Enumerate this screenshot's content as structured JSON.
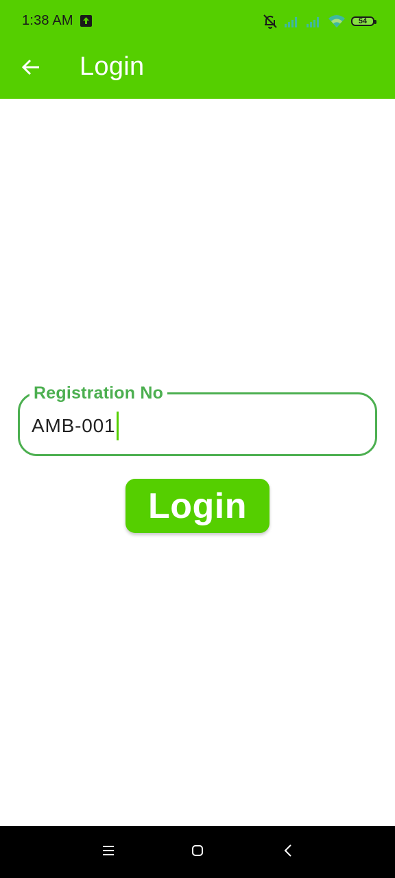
{
  "status_bar": {
    "time": "1:38 AM",
    "battery_level": "54",
    "icons": [
      "upload-icon",
      "bell-off-icon",
      "signal-icon",
      "signal-icon",
      "wifi-icon",
      "battery-icon"
    ]
  },
  "app_bar": {
    "title": "Login",
    "back_icon": "arrow-left-icon"
  },
  "form": {
    "registration_label": "Registration No",
    "registration_value": "AMB-001",
    "login_label": "Login"
  },
  "nav_bar": {
    "icons": [
      "menu-icon",
      "home-icon",
      "back-icon"
    ]
  },
  "colors": {
    "primary": "#55cf00",
    "field_border": "#4caf50"
  }
}
